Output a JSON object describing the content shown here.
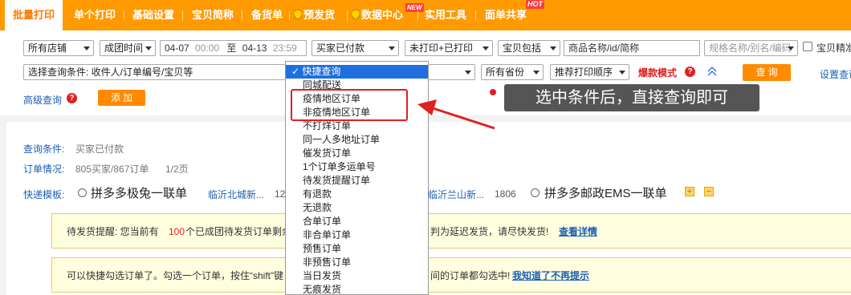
{
  "nav": {
    "items": [
      {
        "label": "批量打印"
      },
      {
        "label": "单个打印"
      },
      {
        "label": "基础设置"
      },
      {
        "label": "宝贝简称"
      },
      {
        "label": "备货单"
      },
      {
        "label": "预发货"
      },
      {
        "label": "数据中心",
        "badge": "NEW"
      },
      {
        "label": "实用工具"
      },
      {
        "label": "面单共享",
        "badge": "HOT"
      }
    ]
  },
  "filters": {
    "shop": "所有店铺",
    "time_type": "成团时间",
    "date_from": "04-07",
    "time_from": "00:00",
    "date_to_sep": "至",
    "date_to": "04-13",
    "time_to": "23:59",
    "order_status": "买家已付款",
    "print_status": "未打印+已打印",
    "item_contains": "宝贝包括",
    "item_input_value": "商品名称/id/简称",
    "sku_input_placeholder": "规格名称/别名/编码",
    "exact_checkbox_label": "宝贝精准",
    "query_condition": "选择查询条件: 收件人/订单编号/宝贝等",
    "province": "所有省份",
    "print_order": "推荐打印顺序",
    "hot_mode": "爆款模式",
    "query_button": "查 询",
    "settings_link": "设置查询",
    "advanced_link": "高级查询",
    "add_button": "添 加",
    "collapse_icon": "double-chevron-up-icon"
  },
  "quick_query_dropdown": {
    "selected": "快捷查询",
    "options": [
      "快捷查询",
      "同城配送",
      "疫情地区订单",
      "非疫情地区订单",
      "不打烊订单",
      "同一人多地址订单",
      "催发货订单",
      "1个订单多运单号",
      "待发货提醒订单",
      "有退款",
      "无退款",
      "合单订单",
      "非合单订单",
      "预售订单",
      "非预售订单",
      "当日发货",
      "无痕发货"
    ],
    "highlighted": [
      "疫情地区订单",
      "非疫情地区订单"
    ]
  },
  "annotation": {
    "tooltip": "选中条件后，直接查询即可"
  },
  "summary": {
    "query_condition_label": "查询条件:",
    "query_condition_value": "买家已付款",
    "order_status_label": "订单情况:",
    "order_status_value": "805买家/867订单",
    "page_indicator": "1/2页",
    "template_label": "快递模板:",
    "templates": [
      {
        "name": "拼多多极兔一联单",
        "sub": "临沂北城新...",
        "count": "12"
      },
      {
        "name": "",
        "sub": "临沂兰山新...",
        "count": "1806"
      },
      {
        "name": "拼多多邮政EMS一联单",
        "sub": "",
        "count": ""
      }
    ],
    "add_icon": "plus-icon",
    "remove_icon": "minus-icon"
  },
  "notices": [
    {
      "prefix": "待发货提醒:  您当前有 ",
      "count": "100",
      "suffix": "个已成团待发货订单剩余",
      "tail": "判为延迟发货，请尽快发货!",
      "link": "查看详情"
    },
    {
      "text": "可以快捷勾选订单了。勾选一个订单，按住“shift”键",
      "tail": "间的订单都勾选中!",
      "link": "我知道了不再提示"
    }
  ],
  "colors": {
    "brand_orange": "#ff9a00",
    "link_blue": "#1a5fb4",
    "highlight_red": "#e02020",
    "dropdown_selected": "#1f6fe0"
  }
}
